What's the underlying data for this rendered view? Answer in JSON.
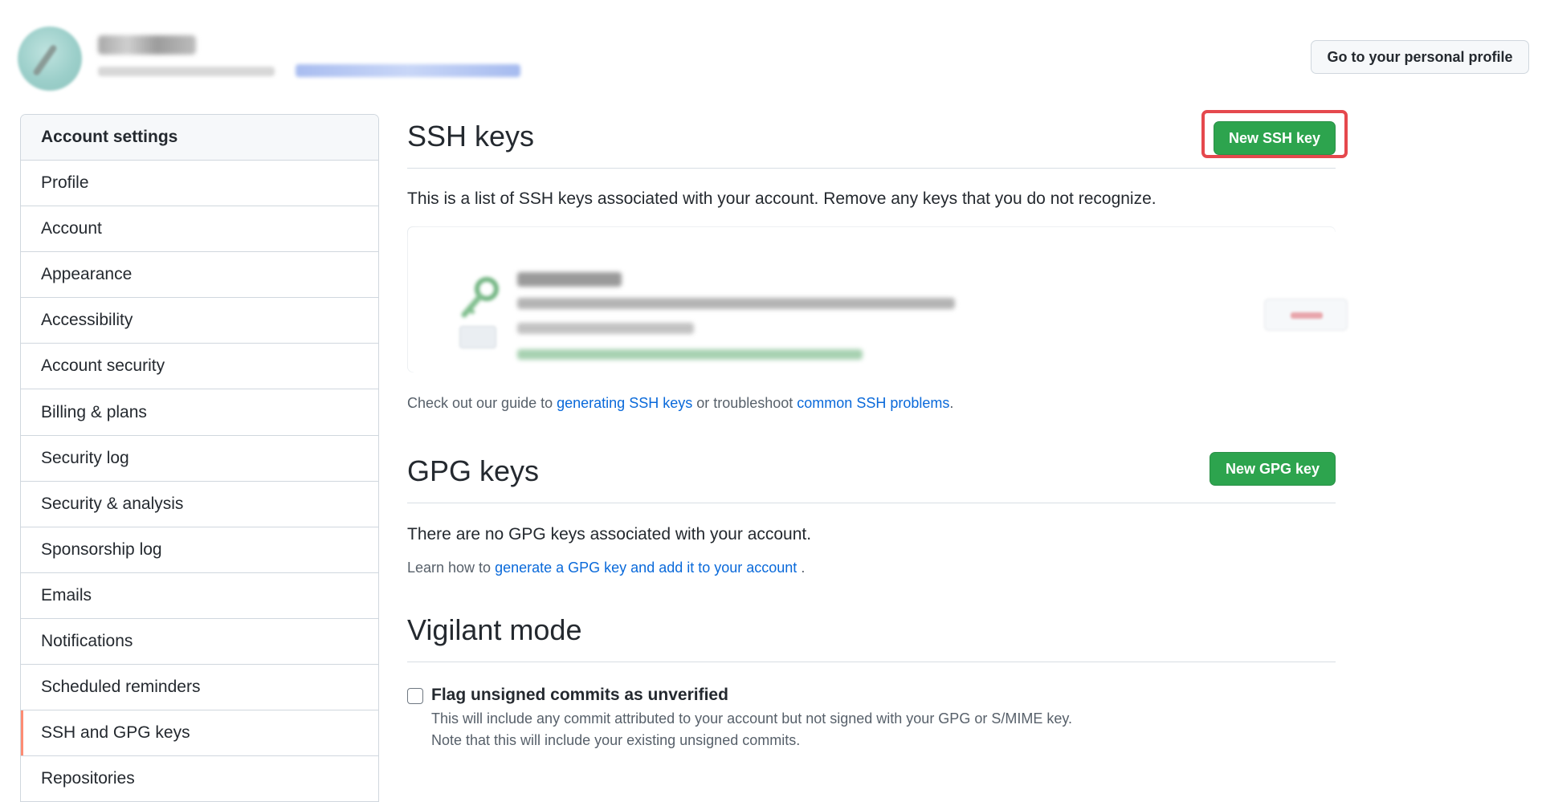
{
  "header": {
    "profile_button_label": "Go to your personal profile"
  },
  "sidebar": {
    "heading": "Account settings",
    "items": [
      {
        "label": "Profile"
      },
      {
        "label": "Account"
      },
      {
        "label": "Appearance"
      },
      {
        "label": "Accessibility"
      },
      {
        "label": "Account security"
      },
      {
        "label": "Billing & plans"
      },
      {
        "label": "Security log"
      },
      {
        "label": "Security & analysis"
      },
      {
        "label": "Sponsorship log"
      },
      {
        "label": "Emails"
      },
      {
        "label": "Notifications"
      },
      {
        "label": "Scheduled reminders"
      },
      {
        "label": "SSH and GPG keys",
        "selected": true
      },
      {
        "label": "Repositories"
      }
    ]
  },
  "ssh": {
    "title": "SSH keys",
    "new_button_label": "New SSH key",
    "description": "This is a list of SSH keys associated with your account. Remove any keys that you do not recognize.",
    "guide_prefix": "Check out our guide to ",
    "guide_link": "generating SSH keys",
    "guide_middle": " or troubleshoot ",
    "troubleshoot_link": "common SSH problems",
    "guide_suffix": "."
  },
  "gpg": {
    "title": "GPG keys",
    "new_button_label": "New GPG key",
    "empty_text": "There are no GPG keys associated with your account.",
    "learn_prefix": "Learn how to ",
    "learn_link": "generate a GPG key and add it to your account",
    "learn_suffix": " ."
  },
  "vigilant": {
    "title": "Vigilant mode",
    "checkbox_label": "Flag unsigned commits as unverified",
    "checked": false,
    "note_line1": "This will include any commit attributed to your account but not signed with your GPG or S/MIME key.",
    "note_line2": "Note that this will include your existing unsigned commits."
  },
  "colors": {
    "primary_green": "#2da44e",
    "link_blue": "#0969da",
    "selected_indicator": "#fd8c73",
    "highlight_red": "#e5484d"
  }
}
